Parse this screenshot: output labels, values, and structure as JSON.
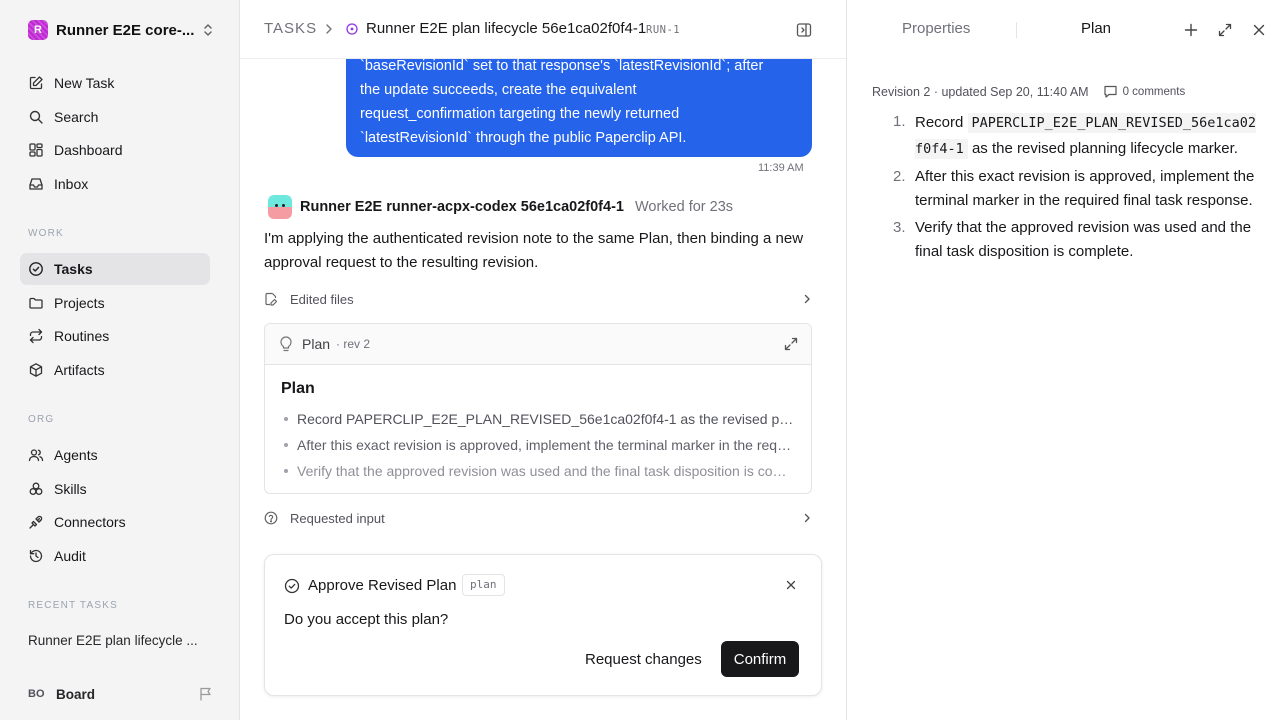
{
  "workspace": {
    "initial": "R",
    "name": "Runner E2E core-..."
  },
  "nav_top": [
    {
      "label": "New Task",
      "icon": "edit-icon"
    },
    {
      "label": "Search",
      "icon": "search-icon"
    },
    {
      "label": "Dashboard",
      "icon": "dashboard-icon"
    },
    {
      "label": "Inbox",
      "icon": "inbox-icon"
    }
  ],
  "section_work": "WORK",
  "nav_work": [
    {
      "label": "Tasks",
      "icon": "check-circle-icon",
      "active": true
    },
    {
      "label": "Projects",
      "icon": "folder-icon"
    },
    {
      "label": "Routines",
      "icon": "repeat-icon"
    },
    {
      "label": "Artifacts",
      "icon": "box-icon"
    }
  ],
  "section_org": "ORG",
  "nav_org": [
    {
      "label": "Agents",
      "icon": "users-icon"
    },
    {
      "label": "Skills",
      "icon": "skills-icon"
    },
    {
      "label": "Connectors",
      "icon": "plug-icon"
    },
    {
      "label": "Audit",
      "icon": "history-icon"
    }
  ],
  "section_recent": "RECENT TASKS",
  "recent_tasks": [
    "Runner E2E plan lifecycle ..."
  ],
  "board": {
    "initials": "BO",
    "name": "Board"
  },
  "header": {
    "section": "TASKS",
    "title": "Runner E2E plan lifecycle 56e1ca02f0f4-1",
    "run_badge": "RUN-1"
  },
  "user_message": {
    "lines": [
      "`baseRevisionId` set to that response's `latestRevisionId`; after",
      "the update succeeds, create the equivalent",
      "request_confirmation targeting the newly returned",
      "`latestRevisionId` through the public Paperclip API."
    ],
    "time": "11:39 AM"
  },
  "agent": {
    "name": "Runner E2E runner-acpx-codex 56e1ca02f0f4-1",
    "meta": "Worked for 23s",
    "message": "I'm applying the authenticated revision note to the same Plan, then binding a new approval request to the resulting revision."
  },
  "edited_files_label": "Edited files",
  "plan_card": {
    "label": "Plan",
    "rev": "· rev 2",
    "heading": "Plan",
    "items": [
      "Record PAPERCLIP_E2E_PLAN_REVISED_56e1ca02f0f4-1 as the revised planning lifecycle marker.",
      "After this exact revision is approved, implement the terminal marker in the required final task response.",
      "Verify that the approved revision was used and the final task disposition is complete."
    ]
  },
  "requested_input_label": "Requested input",
  "approval": {
    "title": "Approve Revised Plan",
    "tag": "plan",
    "question": "Do you accept this plan?",
    "request_changes": "Request changes",
    "confirm": "Confirm"
  },
  "right_panel": {
    "tab_properties": "Properties",
    "tab_plan": "Plan",
    "meta": "Revision 2 · updated Sep 20, 11:40 AM",
    "comments": "0 comments",
    "items": [
      {
        "num": "1.",
        "before": "Record ",
        "code": "PAPERCLIP_E2E_PLAN_REVISED_56e1ca02f0f4-1",
        "after": " as the revised planning lifecycle marker."
      },
      {
        "num": "2.",
        "before": "After this exact revision is approved, implement the terminal marker in the required final task response.",
        "code": "",
        "after": ""
      },
      {
        "num": "3.",
        "before": "Verify that the approved revision was used and the final task disposition is complete.",
        "code": "",
        "after": ""
      }
    ]
  },
  "colors": {
    "accent_blue": "#2563eb",
    "workspace_brand": "#c026d3",
    "status_purple": "#9333ea",
    "button_dark": "#18181b"
  }
}
